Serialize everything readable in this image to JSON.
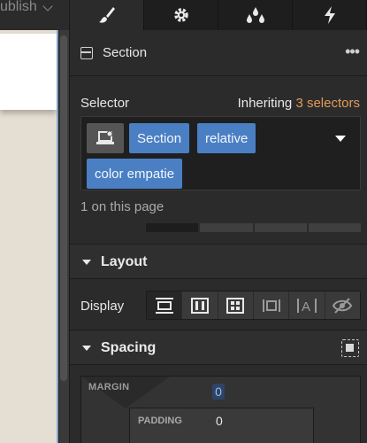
{
  "topbar": {
    "publish_label": "ublish"
  },
  "tabs": [
    {
      "icon": "paintbrush-icon",
      "active": true
    },
    {
      "icon": "gear-icon",
      "active": false
    },
    {
      "icon": "drops-icon",
      "active": false
    },
    {
      "icon": "lightning-icon",
      "active": false
    }
  ],
  "header": {
    "title": "Section",
    "more_icon": "more-icon"
  },
  "selector": {
    "label": "Selector",
    "inheriting_prefix": "Inheriting",
    "inheriting_count": "3 selectors",
    "chips": [
      "Section",
      "relative",
      "color empatie"
    ],
    "on_page": "1 on this page"
  },
  "layout": {
    "title": "Layout",
    "display_label": "Display",
    "display_options": [
      "block",
      "flex",
      "grid",
      "inline-block",
      "inline",
      "none"
    ],
    "selected": "block"
  },
  "spacing": {
    "title": "Spacing",
    "margin_label": "MARGIN",
    "margin_top": "0",
    "padding_label": "PADDING",
    "padding_top": "0"
  },
  "colors": {
    "accent": "#4a7fc4",
    "highlight": "#e39a5a",
    "panel": "#2b2b2b"
  }
}
